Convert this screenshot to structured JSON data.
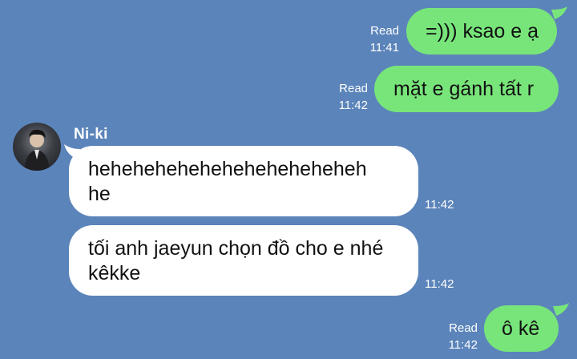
{
  "conversation": {
    "sender_name": "Ni-ki",
    "messages": [
      {
        "direction": "outgoing",
        "text": "=))) ksao e ạ",
        "status": "Read",
        "time": "11:41"
      },
      {
        "direction": "outgoing",
        "text": "mặt e gánh tất r",
        "status": "Read",
        "time": "11:42"
      },
      {
        "direction": "incoming",
        "line1": "heheheheheheheheheheheheh",
        "line2": "he",
        "time": "11:42"
      },
      {
        "direction": "incoming",
        "line1": "tối anh jaeyun chọn đồ cho e nhé",
        "line2": "kêkke",
        "time": "11:42"
      },
      {
        "direction": "outgoing",
        "text": "ô kê",
        "status": "Read",
        "time": "11:42"
      }
    ]
  },
  "colors": {
    "background": "#5b84ba",
    "outgoing_bubble": "#78e57a",
    "incoming_bubble": "#ffffff"
  },
  "icons": {
    "avatar": "profile-photo"
  }
}
